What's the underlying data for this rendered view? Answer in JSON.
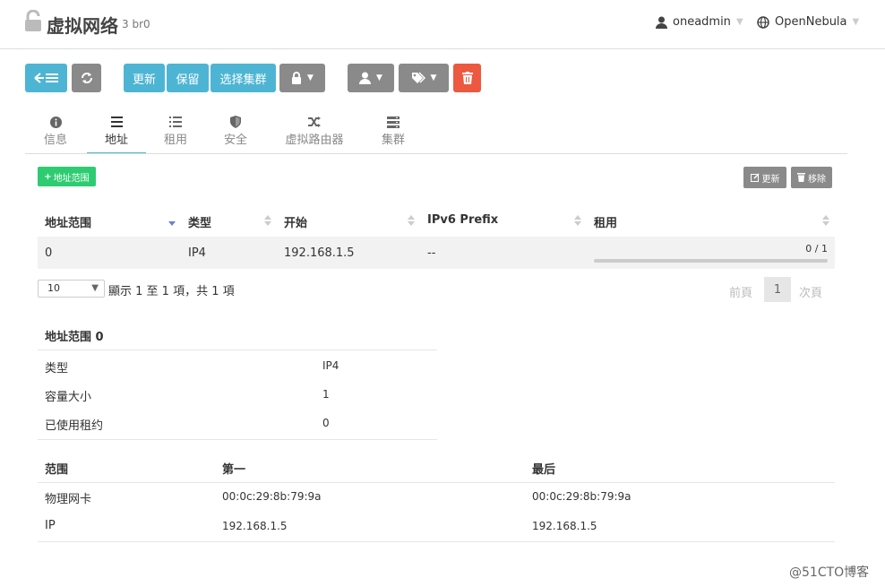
{
  "header": {
    "title": "虚拟网络",
    "subtitle": "3 br0",
    "user": "oneadmin",
    "zone": "OpenNebula"
  },
  "toolbar": {
    "update": "更新",
    "hold": "保留",
    "select_cluster": "选择集群"
  },
  "tabs": [
    {
      "label": "信息",
      "icon": "info-icon"
    },
    {
      "label": "地址",
      "icon": "list-icon"
    },
    {
      "label": "租用",
      "icon": "list-bullet-icon"
    },
    {
      "label": "安全",
      "icon": "shield-icon"
    },
    {
      "label": "虚拟路由器",
      "icon": "random-icon"
    },
    {
      "label": "集群",
      "icon": "server-icon"
    }
  ],
  "active_tab": "地址",
  "ar_actions": {
    "add_range": "地址范围",
    "edit": "更新",
    "remove": "移除"
  },
  "table": {
    "columns": [
      "地址范围",
      "类型",
      "开始",
      "IPv6 Prefix",
      "租用"
    ],
    "rows": [
      {
        "ar": "0",
        "type": "IP4",
        "start": "192.168.1.5",
        "ipv6": "--",
        "leases": "0 / 1",
        "lease_fraction": 0
      }
    ]
  },
  "pagination": {
    "page_size": "10",
    "info": "顯示 1 至 1 項，共 1 項",
    "prev": "前頁",
    "page": "1",
    "next": "次頁"
  },
  "detail": {
    "title": "地址范围 0",
    "rows": [
      {
        "label": "类型",
        "value": "IP4"
      },
      {
        "label": "容量大小",
        "value": "1"
      },
      {
        "label": "已使用租约",
        "value": "0"
      }
    ],
    "range_headers": [
      "范围",
      "第一",
      "最后"
    ],
    "range_rows": [
      {
        "label": "物理网卡",
        "first": "00:0c:29:8b:79:9a",
        "last": "00:0c:29:8b:79:9a"
      },
      {
        "label": "IP",
        "first": "192.168.1.5",
        "last": "192.168.1.5"
      }
    ]
  },
  "watermark": "@51CTO博客",
  "colors": {
    "accent": "#4db5d3",
    "gray_button": "#8a8a8a",
    "danger": "#ec5840",
    "success": "#2ecc71"
  }
}
